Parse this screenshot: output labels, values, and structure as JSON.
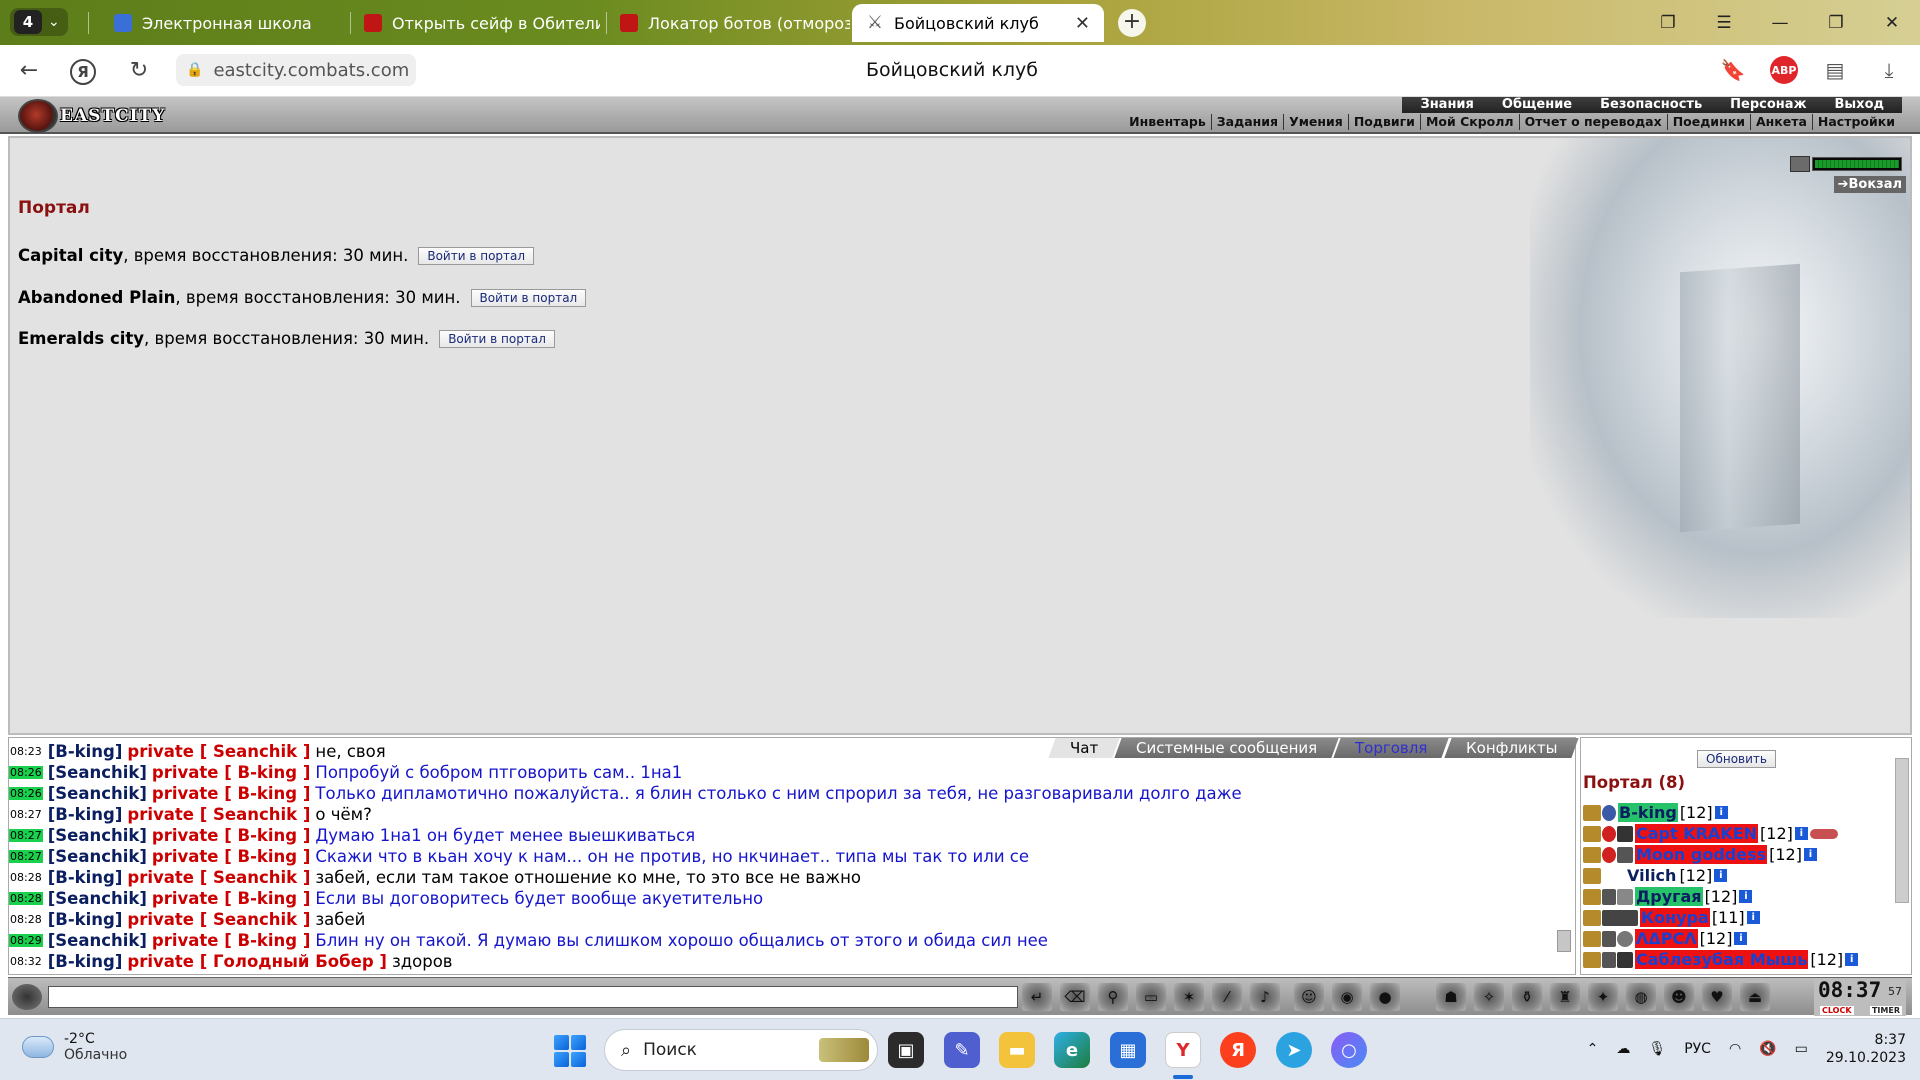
{
  "browser": {
    "tab_count": "4",
    "tabs": [
      {
        "label": "Электронная школа",
        "color": "#3a6fd8"
      },
      {
        "label": "Открыть сейф в Обители ...",
        "color": "#c01515"
      },
      {
        "label": "Локатор ботов (отморозк...",
        "color": "#c01515"
      },
      {
        "label": "Бойцовский клуб",
        "color": "#555555",
        "active": true
      }
    ],
    "url": "eastcity.combats.com",
    "page_title": "Бойцовский клуб",
    "abp": "ABP"
  },
  "game": {
    "logo": "EASTCITY",
    "main_menu": [
      "Знания",
      "Общение",
      "Безопасность",
      "Персонаж",
      "Выход"
    ],
    "sub_menu": [
      "Инвентарь",
      "Задания",
      "Умения",
      "Подвиги",
      "Мой Скролл",
      "Отчет о переводах",
      "Поединки",
      "Анкета",
      "Настройки"
    ],
    "station_link": "Вокзал",
    "energy_level": 1.0,
    "portal": {
      "title": "Портал",
      "rows": [
        {
          "city": "Capital city",
          "text": ", время восстановления: 30 мин.",
          "button": "Войти в портал"
        },
        {
          "city": "Abandoned Plain",
          "text": ", время восстановления: 30 мин.",
          "button": "Войти в портал"
        },
        {
          "city": "Emeralds city",
          "text": ", время восстановления: 30 мин.",
          "button": "Войти в портал"
        }
      ]
    },
    "chat_tabs": [
      "Чат",
      "Системные сообщения",
      "Торговля",
      "Конфликты"
    ],
    "chat": [
      {
        "time": "08:23",
        "hl": false,
        "from": "[B-king]",
        "to": "private [ Seanchik ]",
        "msg": "не, своя",
        "black": true
      },
      {
        "time": "08:26",
        "hl": true,
        "from": "[Seanchik]",
        "to": "private [ B-king ]",
        "msg": "Попробуй с бобром птговорить сам.. 1на1",
        "black": false
      },
      {
        "time": "08:26",
        "hl": true,
        "from": "[Seanchik]",
        "to": "private [ B-king ]",
        "msg": "Только дипламотично пожалуйста.. я блин столько с ним спрорил за тебя, не разговаривали долго даже",
        "black": false
      },
      {
        "time": "08:27",
        "hl": false,
        "from": "[B-king]",
        "to": "private [ Seanchik ]",
        "msg": "о чём?",
        "black": true
      },
      {
        "time": "08:27",
        "hl": true,
        "from": "[Seanchik]",
        "to": "private [ B-king ]",
        "msg": "Думаю 1на1 он будет менее выешкиваться",
        "black": false
      },
      {
        "time": "08:27",
        "hl": true,
        "from": "[Seanchik]",
        "to": "private [ B-king ]",
        "msg": "Скажи что в кьан хочу к нам... он не против, но нкчинает.. типа мы так то или се",
        "black": false
      },
      {
        "time": "08:28",
        "hl": false,
        "from": "[B-king]",
        "to": "private [ Seanchik ]",
        "msg": "забей, если там такое отношение ко мне, то это все не важно",
        "black": true
      },
      {
        "time": "08:28",
        "hl": true,
        "from": "[Seanchik]",
        "to": "private [ B-king ]",
        "msg": "Если вы договоритесь будет вообще акуетительно",
        "black": false
      },
      {
        "time": "08:28",
        "hl": false,
        "from": "[B-king]",
        "to": "private [ Seanchik ]",
        "msg": "забей",
        "black": true
      },
      {
        "time": "08:29",
        "hl": true,
        "from": "[Seanchik]",
        "to": "private [ B-king ]",
        "msg": "Блин ну он такой. Я думаю вы слишком хорошо общались от этого и обида сил нее",
        "black": false
      },
      {
        "time": "08:32",
        "hl": false,
        "from": "[B-king]",
        "to": "private [ Голодный Бобер ]",
        "msg": "здоров",
        "black": true
      }
    ],
    "online": {
      "refresh": "Обновить",
      "title": "Портал (8)",
      "users": [
        {
          "name": "B-king",
          "level": "[12]",
          "style": "green"
        },
        {
          "name": "Capt KRAKEN",
          "level": "[12]",
          "style": "red"
        },
        {
          "name": "Moon goddess",
          "level": "[12]",
          "style": "red"
        },
        {
          "name": "Vilich",
          "level": "[12]",
          "style": "plain"
        },
        {
          "name": "Другая",
          "level": "[12]",
          "style": "green"
        },
        {
          "name": "Конура",
          "level": "[11]",
          "style": "red"
        },
        {
          "name": "ΛΔΡCΛ",
          "level": "[12]",
          "style": "red"
        },
        {
          "name": "Саблезубая Мышь",
          "level": "[12]",
          "style": "red"
        }
      ]
    },
    "clock": {
      "time": "08:37",
      "sec": "57",
      "clock_label": "CLOCK",
      "timer_label": "TIMER"
    }
  },
  "taskbar": {
    "temp": "-2°C",
    "weather": "Облачно",
    "search": "Поиск",
    "lang": "РУС",
    "time": "8:37",
    "date": "29.10.2023"
  }
}
